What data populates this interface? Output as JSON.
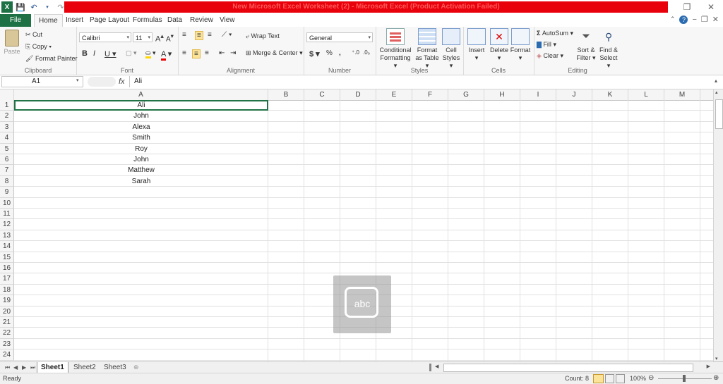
{
  "title_bar": {
    "title": "New Microsoft Excel Worksheet (2) - Microsoft Excel (Product Activation Failed)"
  },
  "ribbon_tabs": [
    "File",
    "Home",
    "Insert",
    "Page Layout",
    "Formulas",
    "Data",
    "Review",
    "View"
  ],
  "clipboard": {
    "paste": "Paste",
    "cut": "Cut",
    "copy": "Copy",
    "format_painter": "Format Painter",
    "label": "Clipboard"
  },
  "font": {
    "name": "Calibri",
    "size": "11",
    "label": "Font"
  },
  "alignment": {
    "wrap_text": "Wrap Text",
    "merge_center": "Merge & Center",
    "label": "Alignment"
  },
  "number": {
    "format": "General",
    "label": "Number"
  },
  "styles": {
    "conditional": "Conditional",
    "formatting": "Formatting",
    "format": "Format",
    "as_table": "as Table",
    "cell": "Cell",
    "cell_styles": "Styles",
    "label": "Styles"
  },
  "cells": {
    "insert": "Insert",
    "delete": "Delete",
    "format": "Format",
    "label": "Cells"
  },
  "editing": {
    "autosum": "AutoSum",
    "fill": "Fill",
    "clear": "Clear",
    "sort": "Sort &",
    "filter": "Filter",
    "find": "Find &",
    "select": "Select",
    "label": "Editing"
  },
  "formula_bar": {
    "name_box": "A1",
    "fx": "fx",
    "content": "Ali"
  },
  "columns": [
    "A",
    "B",
    "C",
    "D",
    "E",
    "F",
    "G",
    "H",
    "I",
    "J",
    "K",
    "L",
    "M"
  ],
  "rows": [
    "1",
    "2",
    "3",
    "4",
    "5",
    "6",
    "7",
    "8",
    "9",
    "10",
    "11",
    "12",
    "13",
    "14",
    "15",
    "16",
    "17",
    "18",
    "19",
    "20",
    "21",
    "22",
    "23",
    "24"
  ],
  "column_a_values": [
    "Ali",
    "John",
    "Alexa",
    "Smith",
    "Roy",
    "John",
    "Matthew",
    "Sarah"
  ],
  "sheets": [
    "Sheet1",
    "Sheet2",
    "Sheet3"
  ],
  "status": {
    "ready": "Ready",
    "count": "Count: 8",
    "zoom": "100%"
  },
  "overlay": {
    "text": "abc"
  },
  "colors": {
    "title_red": "#e8000b",
    "file_green": "#1e7145"
  }
}
